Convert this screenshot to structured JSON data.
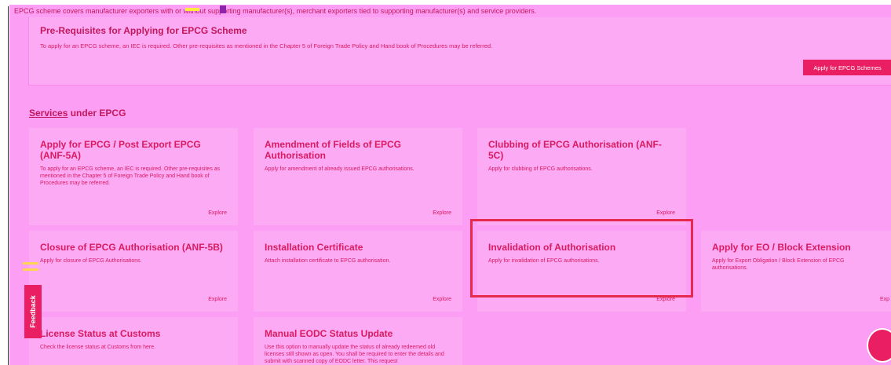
{
  "top_line": "EPCG scheme covers manufacturer exporters with or without supporting manufacturer(s), merchant exporters tied to supporting manufacturer(s) and service providers.",
  "prereq": {
    "title": "Pre-Requisites for Applying for EPCG Scheme",
    "text": "To apply for an EPCG scheme, an IEC is required. Other pre-requisites as mentioned in the Chapter 5 of Foreign Trade Policy and Hand book of Procedures may be referred.",
    "apply_button": "Apply for EPCG Schemes"
  },
  "section": {
    "title_part1": "Services",
    "title_part2": " under EPCG"
  },
  "cards": [
    {
      "title": "Apply for EPCG / Post Export EPCG (ANF-5A)",
      "desc": "To apply for an EPCG scheme, an IEC is required. Other pre-requisites as mentioned in the Chapter 5 of Foreign Trade Policy and Hand book of Procedures may be referred.",
      "link": "Explore"
    },
    {
      "title": "Amendment of Fields of EPCG Authorisation",
      "desc": "Apply for amendment of already issued EPCG authorisations.",
      "link": "Explore"
    },
    {
      "title": "Clubbing of EPCG Authorisation (ANF-5C)",
      "desc": "Apply for clubbing of EPCG authorisations.",
      "link": "Explore"
    },
    {
      "title": "Closure of EPCG Authorisation (ANF-5B)",
      "desc": "Apply for closure of EPCG Authorisations.",
      "link": "Explore"
    },
    {
      "title": "Installation Certificate",
      "desc": "Attach installation certificate to EPCG authorisation.",
      "link": "Explore"
    },
    {
      "title": "Invalidation of Authorisation",
      "desc": "Apply for invalidation of EPCG authorisations.",
      "link": "Explore"
    },
    {
      "title": "Apply for EO / Block Extension",
      "desc": "Apply for Export Obligation / Block Extension of EPCG authorisations.",
      "link": "Exp"
    },
    {
      "title": "License Status at Customs",
      "desc": "Check the license status at Customs from here.",
      "link": ""
    },
    {
      "title": "Manual EODC Status Update",
      "desc": "Use this option to manually update the status of already redeemed old licenses still shown as open. You shall be required to enter the details and submit with scanned copy of EODC letter. This request",
      "link": ""
    }
  ],
  "feedback": "Feedback",
  "colors": {
    "accent": "#e91e63",
    "background": "#fc9ef4",
    "card": "#fdaaf5",
    "highlight": "#e8294e"
  }
}
